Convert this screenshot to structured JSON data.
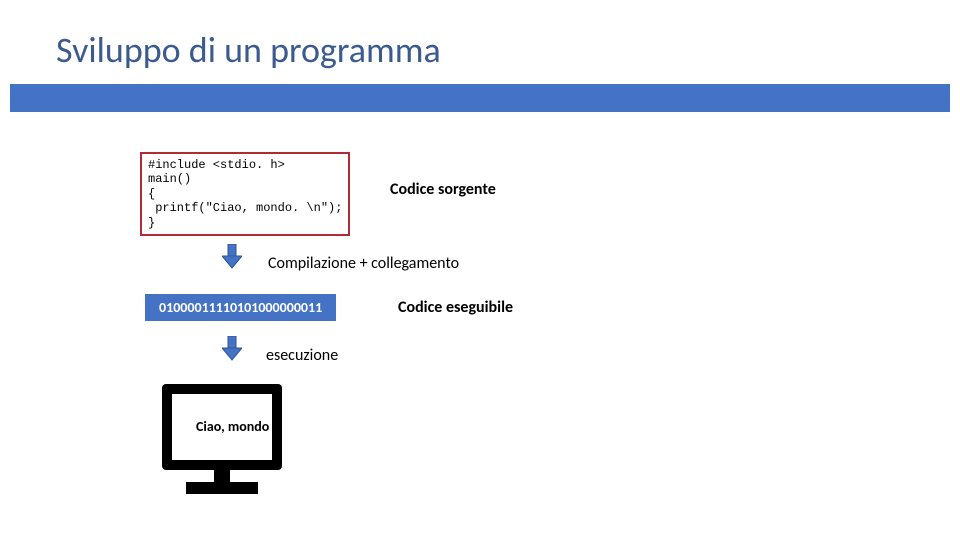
{
  "title": "Sviluppo di un programma",
  "source_code": "#include <stdio. h>\nmain()\n{\n printf(\"Ciao, mondo. \\n\");\n}",
  "label_source": "Codice sorgente",
  "label_compile": "Compilazione + collegamento",
  "binary_string": "01000011110101000000011",
  "label_executable": "Codice eseguibile",
  "label_execution": "esecuzione",
  "output_text": "Ciao, mondo"
}
